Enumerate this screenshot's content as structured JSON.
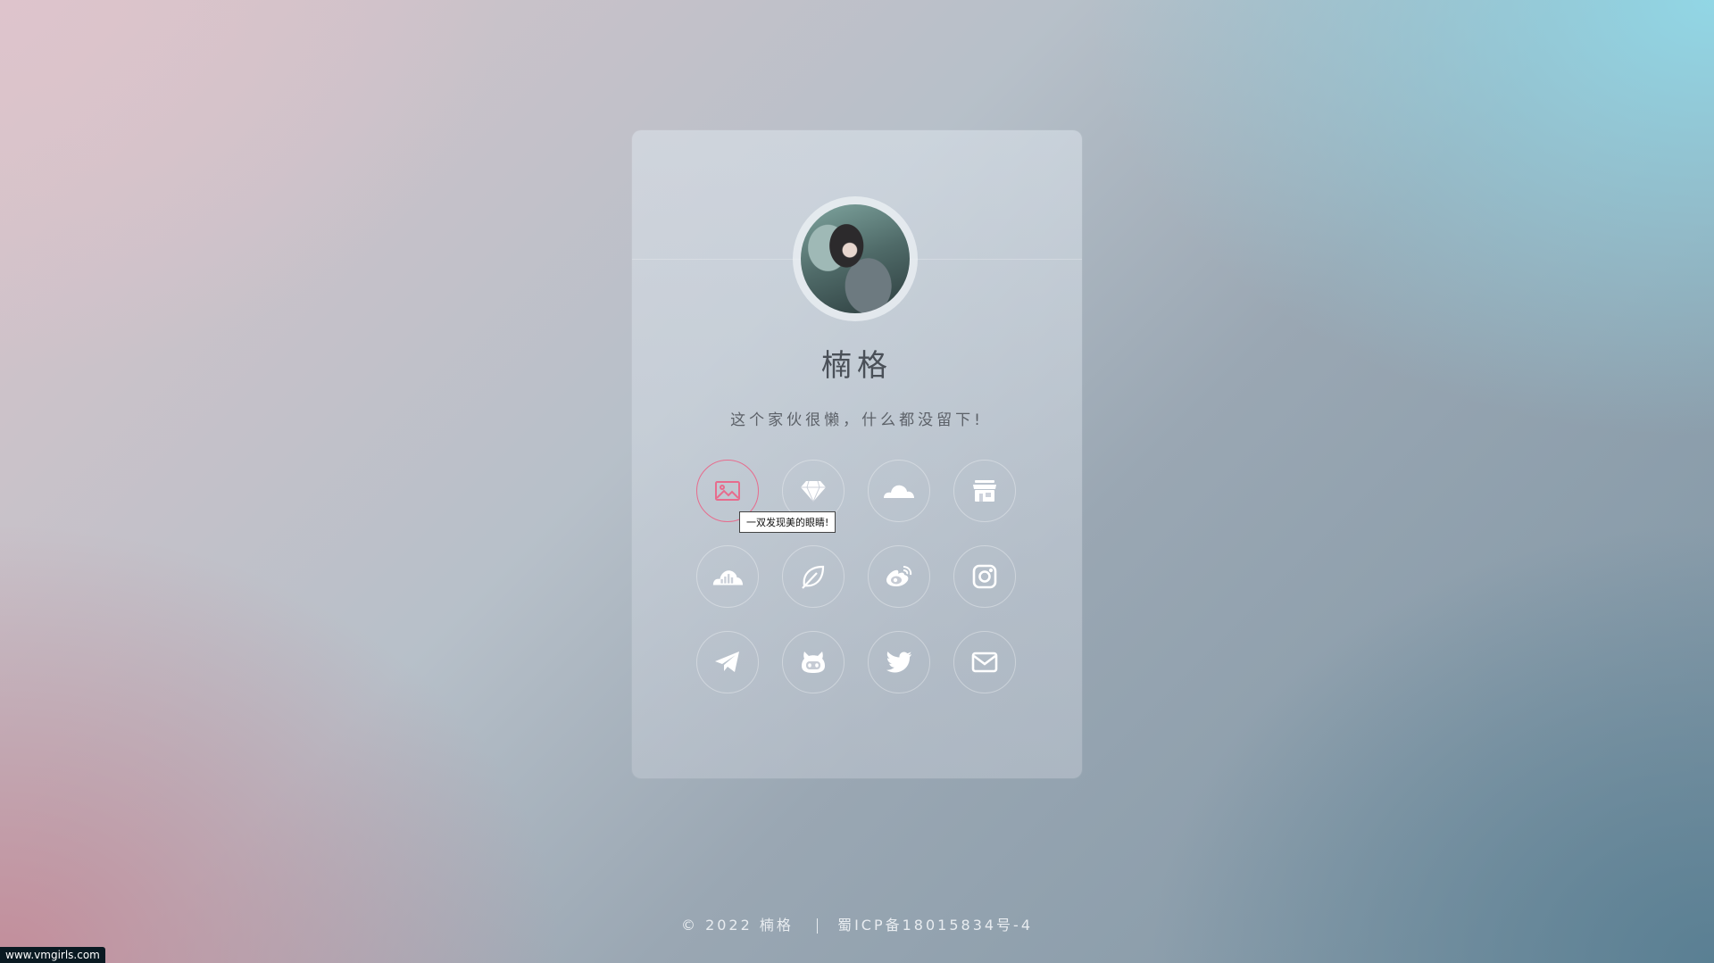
{
  "profile": {
    "name": "楠格",
    "bio": "这个家伙很懒，什么都没留下!"
  },
  "links": [
    {
      "icon": "image-icon",
      "active": true
    },
    {
      "icon": "diamond-icon"
    },
    {
      "icon": "cloud-icon"
    },
    {
      "icon": "store-icon"
    },
    {
      "icon": "cloud-chart-icon"
    },
    {
      "icon": "leaf-icon"
    },
    {
      "icon": "weibo-icon"
    },
    {
      "icon": "instagram-icon"
    },
    {
      "icon": "telegram-icon"
    },
    {
      "icon": "github-icon"
    },
    {
      "icon": "twitter-icon"
    },
    {
      "icon": "mail-icon"
    }
  ],
  "tooltip": {
    "text": "一双发现美的眼睛!"
  },
  "footer": {
    "copyright": "© 2022 楠格",
    "icp": "蜀ICP备18015834号-4"
  },
  "watermark": {
    "text": "www.vmgirls.com"
  },
  "colors": {
    "accent": "#e76c8d",
    "icon": "#ffffff"
  }
}
